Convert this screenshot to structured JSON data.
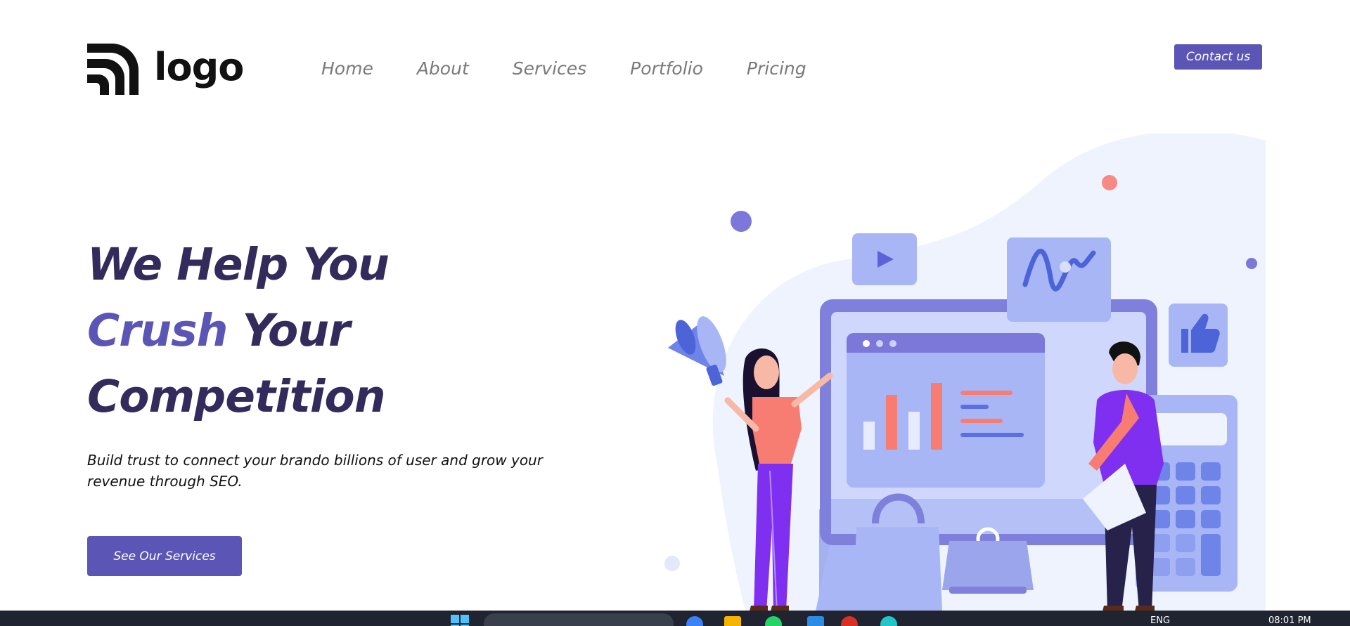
{
  "header": {
    "logo_text": "logo",
    "nav": [
      {
        "label": "Home"
      },
      {
        "label": "About"
      },
      {
        "label": "Services"
      },
      {
        "label": "Portfolio"
      },
      {
        "label": "Pricing"
      }
    ],
    "contact_label": "Contact us"
  },
  "hero": {
    "line1": "We Help You",
    "line2_accent": "Crush",
    "line2_rest": " Your",
    "line3": "Competition",
    "subtitle": "Build trust to connect your brando billions of user and grow your revenue through SEO.",
    "cta_label": "See Our Services"
  },
  "taskbar": {
    "language": "ENG",
    "time": "08:01 PM"
  },
  "colors": {
    "accent": "#5b55b6",
    "heading": "#332b5c",
    "nav_text": "#7a7a7a",
    "illustration_blob": "#eef3fe",
    "illustration_periwinkle": "#a9b6f6",
    "illustration_coral": "#f77c72",
    "illustration_purple": "#7f4df0"
  },
  "icons": [
    "logo-arcs-icon",
    "megaphone-icon",
    "play-icon",
    "wave-chart-icon",
    "thumbs-up-icon",
    "calculator-icon",
    "windows-start-icon"
  ]
}
